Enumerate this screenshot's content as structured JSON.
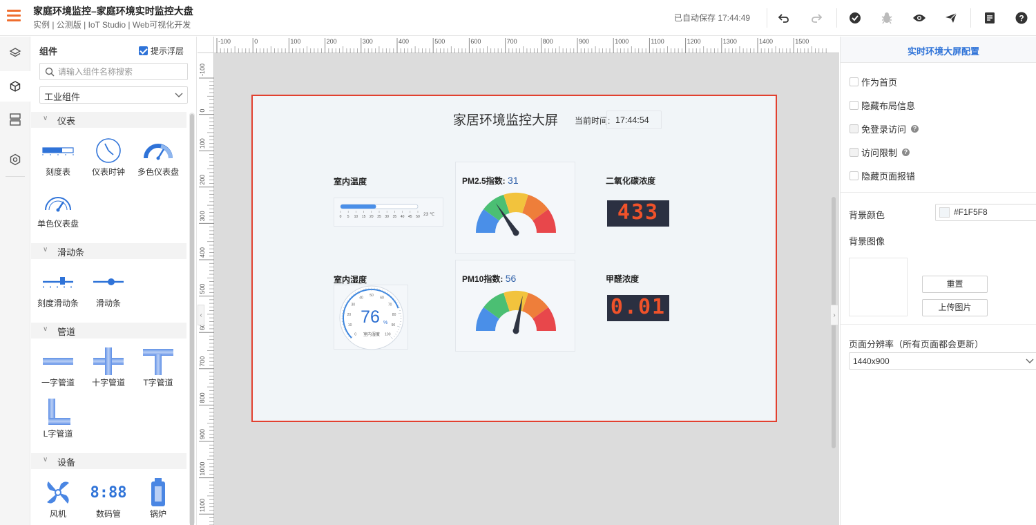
{
  "header": {
    "title": "家庭环境监控–家庭环境实时监控大盘",
    "subtitle": "实例 | 公测版 | IoT Studio | Web可视化开发",
    "autosave": "已自动保存 17:44:49"
  },
  "panel": {
    "title": "组件",
    "float_hint": "提示浮层",
    "search_placeholder": "请输入组件名称搜索",
    "category": "工业组件",
    "sections": {
      "meter": {
        "title": "仪表",
        "items": [
          "刻度表",
          "仪表时钟",
          "多色仪表盘",
          "单色仪表盘"
        ]
      },
      "slider": {
        "title": "滑动条",
        "items": [
          "刻度滑动条",
          "滑动条"
        ]
      },
      "pipe": {
        "title": "管道",
        "items": [
          "一字管道",
          "十字管道",
          "T字管道",
          "L字管道"
        ]
      },
      "device": {
        "title": "设备",
        "items": [
          "风机",
          "数码管",
          "锅炉"
        ],
        "digit_icon_text": "8:88"
      }
    }
  },
  "ruler": {
    "top": [
      "-100",
      "0",
      "100",
      "200",
      "300",
      "400",
      "500",
      "600",
      "700",
      "800",
      "900",
      "1000",
      "1100",
      "1200",
      "1300",
      "1400",
      "1500"
    ],
    "left": [
      "-100",
      "0",
      "100",
      "200",
      "300",
      "400",
      "500",
      "600",
      "700",
      "800",
      "900",
      "1000",
      "1100"
    ]
  },
  "screen": {
    "title": "家居环境监控大屏",
    "time_label": "当前时间:",
    "time_value": "17:44:54",
    "temp_label": "室内温度",
    "temp_value_text": "23 ℃",
    "temp_fill": 0.46,
    "temp_ticks": [
      "0",
      "5",
      "10",
      "15",
      "20",
      "25",
      "30",
      "35",
      "40",
      "45",
      "50"
    ],
    "humid_label": "室内湿度",
    "humid_value": "76",
    "humid_unit": "%",
    "humid_inner_label": "室内湿度",
    "humid_ticks": [
      "0",
      "10",
      "20",
      "30",
      "40",
      "50",
      "60",
      "70",
      "80",
      "90",
      "100"
    ],
    "pm25_label": "PM2.5指数:",
    "pm25_value": "31",
    "pm10_label": "PM10指数:",
    "pm10_value": "56",
    "co2_label": "二氧化碳浓度",
    "co2_value": "433",
    "hcho_label": "甲醛浓度",
    "hcho_value": "0.01",
    "gauge_colors": [
      "#4a8fe8",
      "#4bbf73",
      "#f2c33d",
      "#ee7e3a",
      "#e8474b"
    ]
  },
  "rpanel": {
    "title": "实时环境大屏配置",
    "options": [
      "作为首页",
      "隐藏布局信息",
      "免登录访问",
      "访问限制",
      "隐藏页面报错"
    ],
    "bg_color_label": "背景颜色",
    "bg_color_value": "#F1F5F8",
    "bg_image_label": "背景图像",
    "reset_button": "重置",
    "upload_button": "上传图片",
    "resolution_label": "页面分辨率（所有页面都会更新）",
    "resolution_value": "1440x900"
  }
}
